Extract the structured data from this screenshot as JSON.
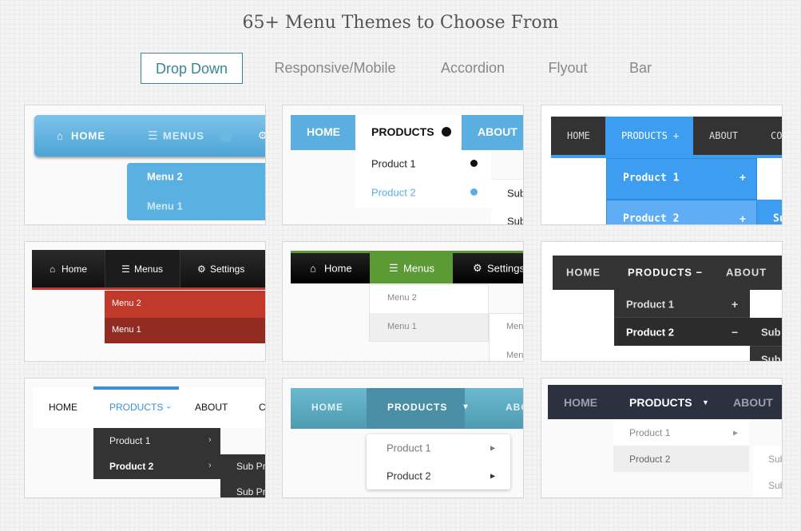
{
  "title": "65+ Menu Themes to Choose From",
  "tabs": [
    {
      "label": "Drop Down",
      "active": true
    },
    {
      "label": "Responsive/Mobile"
    },
    {
      "label": "Accordion"
    },
    {
      "label": "Flyout"
    },
    {
      "label": "Bar"
    }
  ],
  "cards": [
    {
      "nav": [
        "HOME",
        "MENUS"
      ],
      "sub": [
        "Menu 2",
        "Menu 1"
      ],
      "color": "#5aafe0"
    },
    {
      "nav": [
        "HOME",
        "PRODUCTS",
        "ABOUT"
      ],
      "sub": [
        "Product 1",
        "Product 2"
      ],
      "subsub": [
        "Sub",
        "Sub"
      ],
      "color": "#5aafe0"
    },
    {
      "nav": [
        "HOME",
        "PRODUCTS +",
        "ABOUT",
        "CO"
      ],
      "sub": [
        "Product 1",
        "Product 2"
      ],
      "subsub": [
        "Su"
      ],
      "sub_icon": "+",
      "color": "#3d9df0"
    },
    {
      "nav": [
        "Home",
        "Menus",
        "Settings"
      ],
      "sub": [
        "Menu 2",
        "Menu 1"
      ],
      "color": "#c0392b"
    },
    {
      "nav": [
        "Home",
        "Menus",
        "Settings"
      ],
      "sub": [
        "Menu 2",
        "Menu 1"
      ],
      "subsub": [
        "Men",
        "Men"
      ],
      "color": "#5b9a35"
    },
    {
      "nav": [
        "HOME",
        "PRODUCTS  −",
        "ABOUT"
      ],
      "sub": [
        "Product 1",
        "Product 2"
      ],
      "sub_icons": [
        "+",
        "−"
      ],
      "subsub": [
        "Sub",
        "Sub"
      ],
      "color": "#333333"
    },
    {
      "nav": [
        "HOME",
        "PRODUCTS",
        "ABOUT",
        "C"
      ],
      "sub": [
        "Product 1",
        "Product 2"
      ],
      "subsub": [
        "Sub Pr",
        "Sub Pr"
      ],
      "color": "#3a8fd6"
    },
    {
      "nav": [
        "HOME",
        "PRODUCTS",
        "ABO"
      ],
      "sub": [
        "Product 1",
        "Product 2"
      ],
      "color": "#5aa9c0"
    },
    {
      "nav": [
        "HOME",
        "PRODUCTS",
        "ABOUT"
      ],
      "sub": [
        "Product 1",
        "Product 2"
      ],
      "subsub": [
        "Sub",
        "Sub"
      ],
      "color": "#2c3140"
    }
  ]
}
